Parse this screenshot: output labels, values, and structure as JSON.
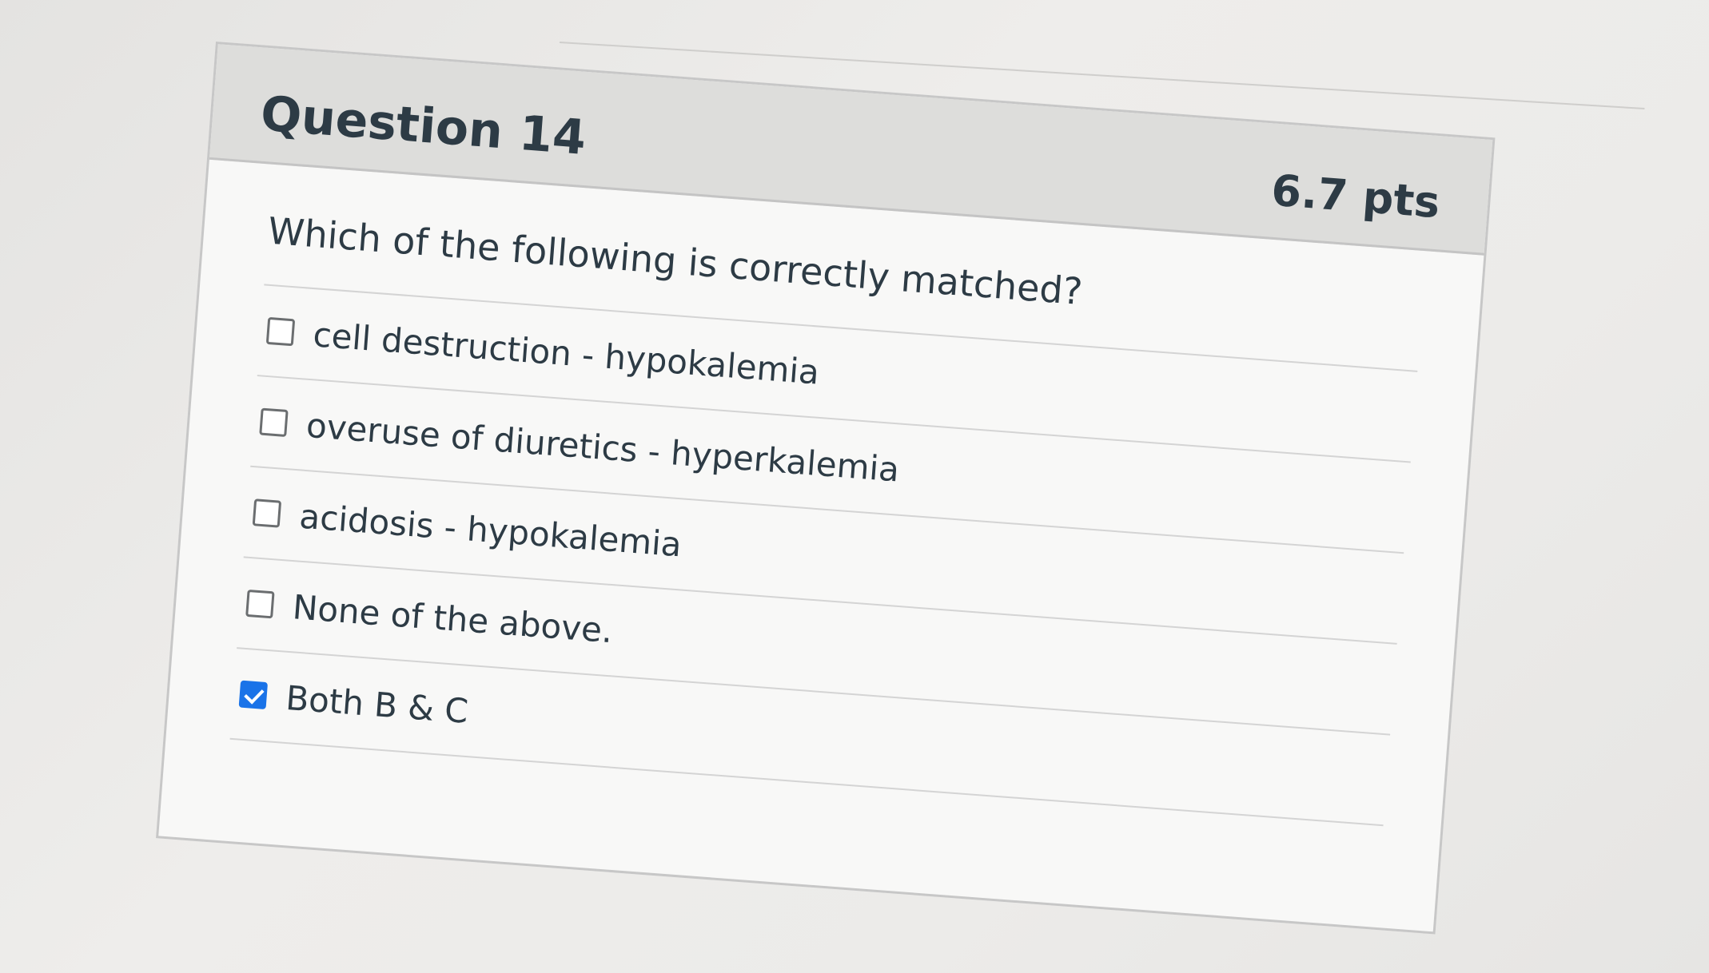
{
  "question": {
    "title": "Question 14",
    "points": "6.7 pts",
    "text": "Which of the following is correctly matched?",
    "answers": [
      {
        "label": "cell destruction - hypokalemia",
        "checked": false
      },
      {
        "label": "overuse of diuretics - hyperkalemia",
        "checked": false
      },
      {
        "label": "acidosis - hypokalemia",
        "checked": false
      },
      {
        "label": "None of the above.",
        "checked": false
      },
      {
        "label": "Both B & C",
        "checked": true
      }
    ]
  },
  "colors": {
    "accent": "#1a73e8",
    "header_bg": "#dddddb",
    "text": "#2d3b45"
  },
  "icons": {
    "checkbox_checked": "checkmark-icon"
  }
}
